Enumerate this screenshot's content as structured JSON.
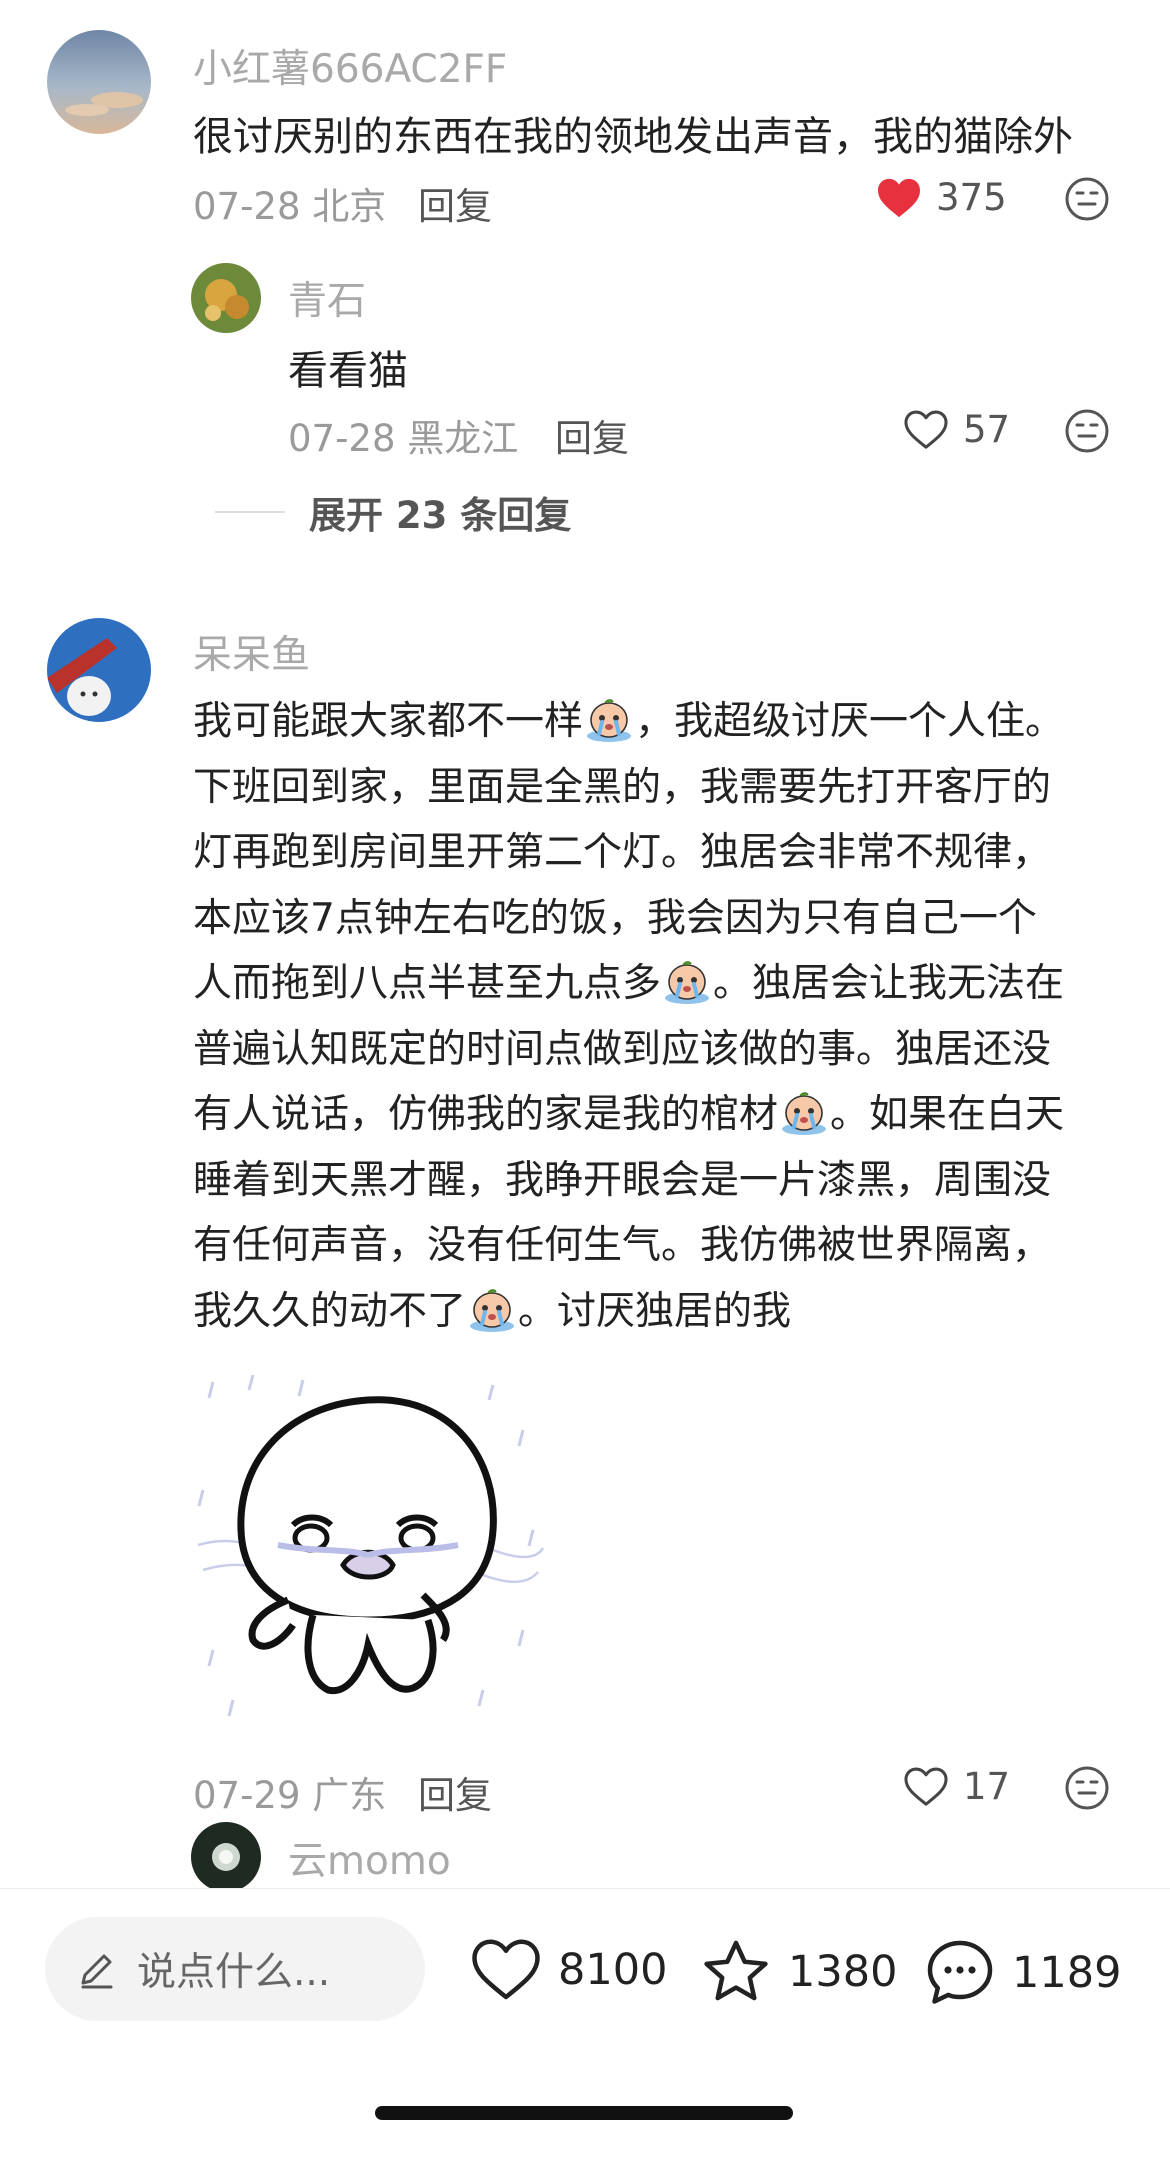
{
  "colors": {
    "like_active": "#e8313f",
    "muted_text": "#9a9a9a",
    "body_text": "#222222"
  },
  "comment1": {
    "username": "小红薯666AC2FF",
    "text": "很讨厌别的东西在我的领地发出声音，我的猫除外",
    "date_location": "07-28 北京",
    "reply_label": "回复",
    "like_count": "375",
    "liked": true
  },
  "reply1": {
    "username": "青石",
    "text": "看看猫",
    "date_location": "07-28 黑龙江",
    "reply_label": "回复",
    "like_count": "57"
  },
  "expand_replies": "展开 23 条回复",
  "comment2": {
    "username": "呆呆鱼",
    "lines": [
      {
        "before": "我可能跟大家都不一样",
        "emoji": "crying-emoji",
        "after": "，我超级讨厌一个人住。"
      },
      {
        "before": "下班回到家，里面是全黑的，我需要先打开客厅的",
        "emoji": "",
        "after": ""
      },
      {
        "before": "灯再跑到房间里开第二个灯。独居会非常不规律，",
        "emoji": "",
        "after": ""
      },
      {
        "before": "本应该7点钟左右吃的饭，我会因为只有自己一个",
        "emoji": "",
        "after": ""
      },
      {
        "before": "人而拖到八点半甚至九点多",
        "emoji": "crying-emoji",
        "after": "。独居会让我无法在"
      },
      {
        "before": "普遍认知既定的时间点做到应该做的事。独居还没",
        "emoji": "",
        "after": ""
      },
      {
        "before": "有人说话，仿佛我的家是我的棺材",
        "emoji": "crying-emoji",
        "after": "。如果在白天"
      },
      {
        "before": "睡着到天黑才醒，我睁开眼会是一片漆黑，周围没",
        "emoji": "",
        "after": ""
      },
      {
        "before": "有任何声音，没有任何生气。我仿佛被世界隔离，",
        "emoji": "",
        "after": ""
      },
      {
        "before": "我久久的动不了",
        "emoji": "crying-emoji",
        "after": "。讨厌独居的我"
      }
    ],
    "sticker": "crying-blob-sticker",
    "date_location": "07-29 广东",
    "reply_label": "回复",
    "like_count": "17"
  },
  "comment3": {
    "username": "云momo"
  },
  "bottom_bar": {
    "input_placeholder": "说点什么...",
    "like_count": "8100",
    "star_count": "1380",
    "comment_count": "1189"
  }
}
